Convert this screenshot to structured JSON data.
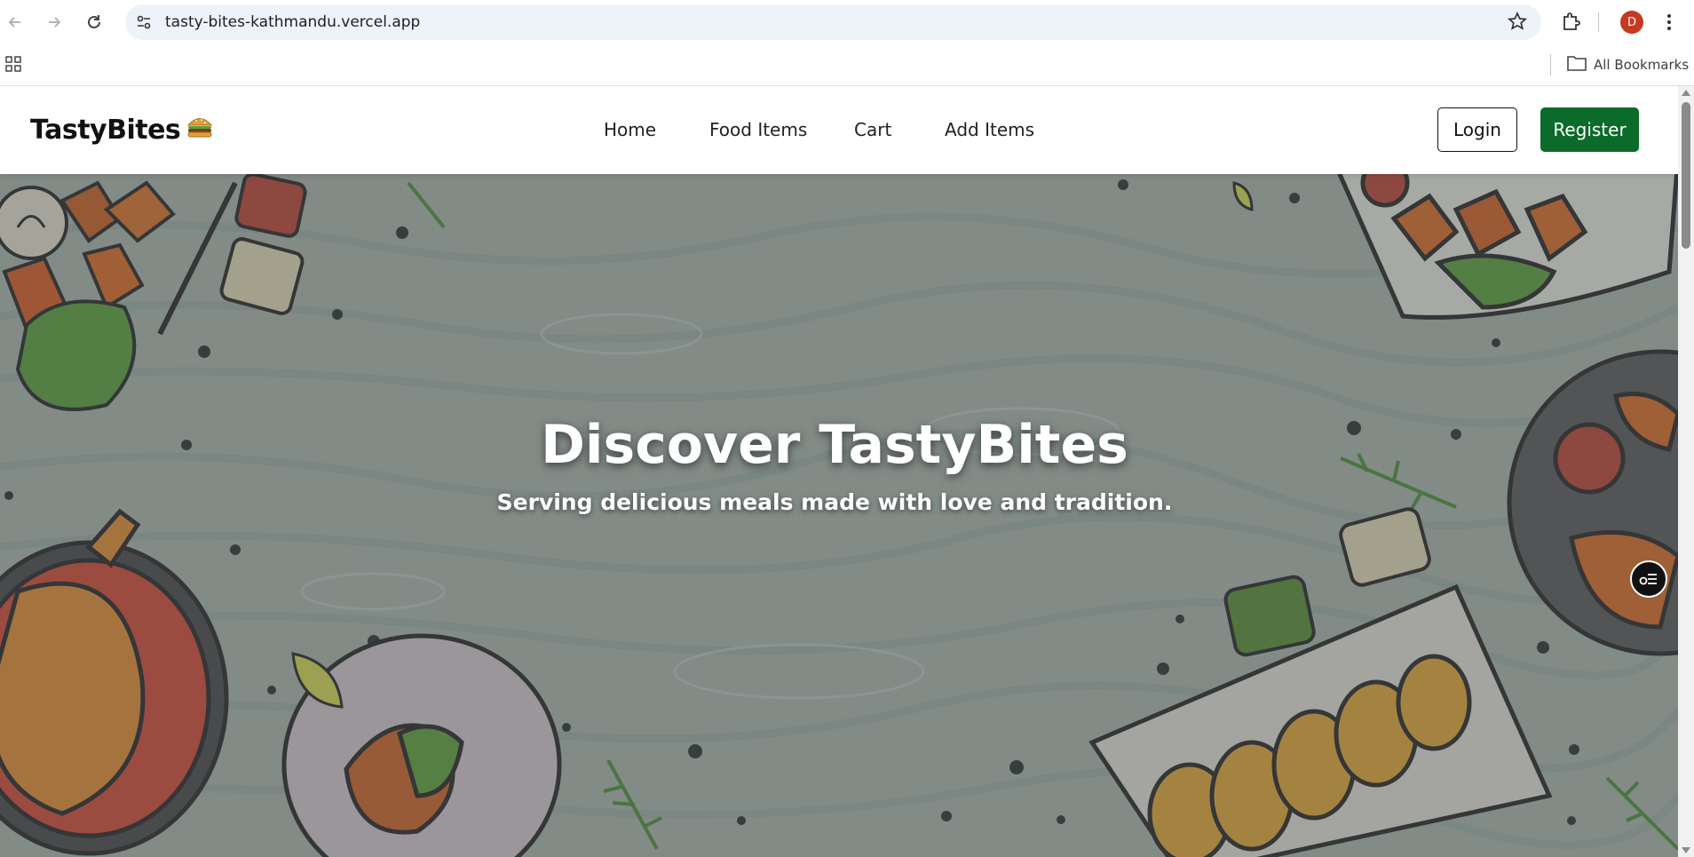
{
  "browser": {
    "url": "tasty-bites-kathmandu.vercel.app",
    "profile_initial": "D",
    "all_bookmarks_label": "All Bookmarks"
  },
  "site": {
    "logo_text": "TastyBites",
    "logo_emoji": "🍔",
    "nav": [
      "Home",
      "Food Items",
      "Cart",
      "Add Items"
    ],
    "login_label": "Login",
    "register_label": "Register",
    "register_color": "#0b6b2a"
  },
  "hero": {
    "title": "Discover TastyBites",
    "subtitle": "Serving delicious meals made with love and tradition."
  },
  "icons": {
    "back": "arrow-left-icon",
    "forward": "arrow-right-icon",
    "reload": "reload-icon",
    "site_info": "tune-icon",
    "bookmark": "star-icon",
    "extensions": "puzzle-icon",
    "menu": "kebab-icon",
    "apps": "apps-grid-icon",
    "folder": "folder-icon",
    "floating": "list-settings-icon"
  }
}
